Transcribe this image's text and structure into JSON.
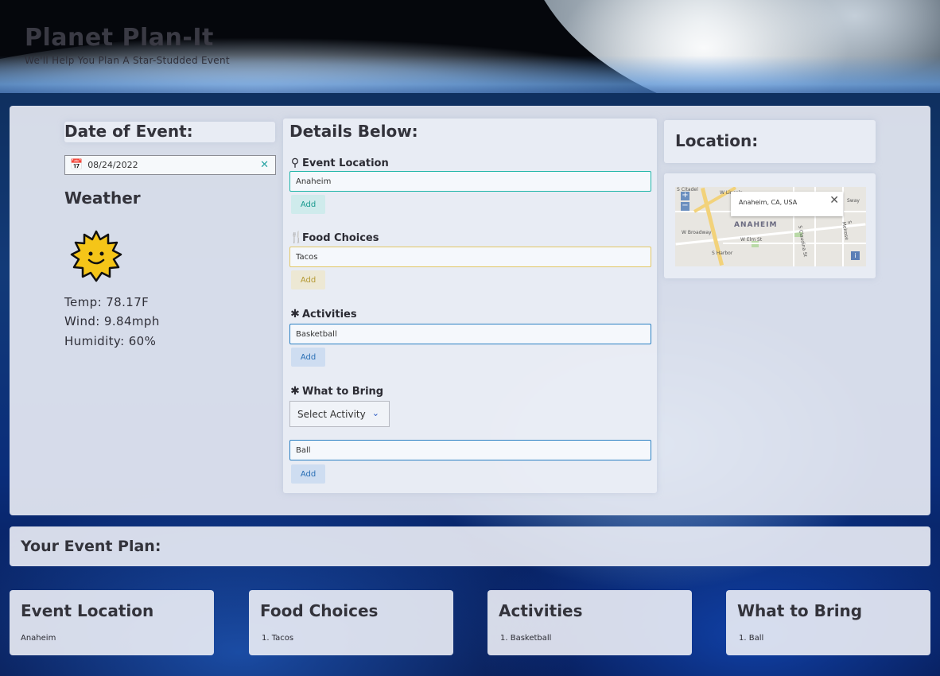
{
  "header": {
    "title": "Planet Plan-It",
    "subtitle": "We'll Help You Plan A Star-Studded Event"
  },
  "date_section": {
    "heading": "Date of Event:",
    "date_value": "08/24/2022",
    "calendar_icon": "calendar-icon",
    "clear_icon": "close-icon"
  },
  "weather": {
    "heading": "Weather",
    "icon": "sun-icon",
    "temp": "Temp: 78.17F",
    "wind": "Wind: 9.84mph",
    "humidity": "Humidity: 60%"
  },
  "details": {
    "heading": "Details Below:",
    "event_location": {
      "label": "Event Location",
      "icon": "map-pin-icon",
      "value": "Anaheim",
      "add_label": "Add",
      "color": "#1fb5a8"
    },
    "food_choices": {
      "label": "Food Choices",
      "icon": "fork-knife-icon",
      "value": "Tacos",
      "add_label": "Add",
      "color": "#e3c765"
    },
    "activities": {
      "label": "Activities",
      "icon": "carrot-icon",
      "value": "Basketball",
      "add_label": "Add",
      "color": "#2a7fc2"
    },
    "what_to_bring": {
      "label": "What to Bring",
      "icon": "carrot-icon",
      "select_value": "Select Activity",
      "value": "Ball",
      "add_label": "Add",
      "color": "#2a7fc2"
    }
  },
  "location": {
    "heading": "Location:",
    "map": {
      "popup_text": "Anaheim, CA, USA",
      "city_label": "ANAHEIM",
      "zoom_in": "+",
      "zoom_out": "−",
      "info": "i",
      "streets": [
        "W Lincoln",
        "Sway",
        "W Broadway",
        "W Elm St",
        "S Citadel",
        "S Harbor",
        "S Claudina St",
        "S Melrose"
      ]
    }
  },
  "plan": {
    "heading": "Your Event Plan:",
    "cards": [
      {
        "title": "Event Location",
        "item": "Anaheim"
      },
      {
        "title": "Food Choices",
        "item": "1. Tacos"
      },
      {
        "title": "Activities",
        "item": "1. Basketball"
      },
      {
        "title": "What to Bring",
        "item": "1. Ball"
      }
    ]
  }
}
